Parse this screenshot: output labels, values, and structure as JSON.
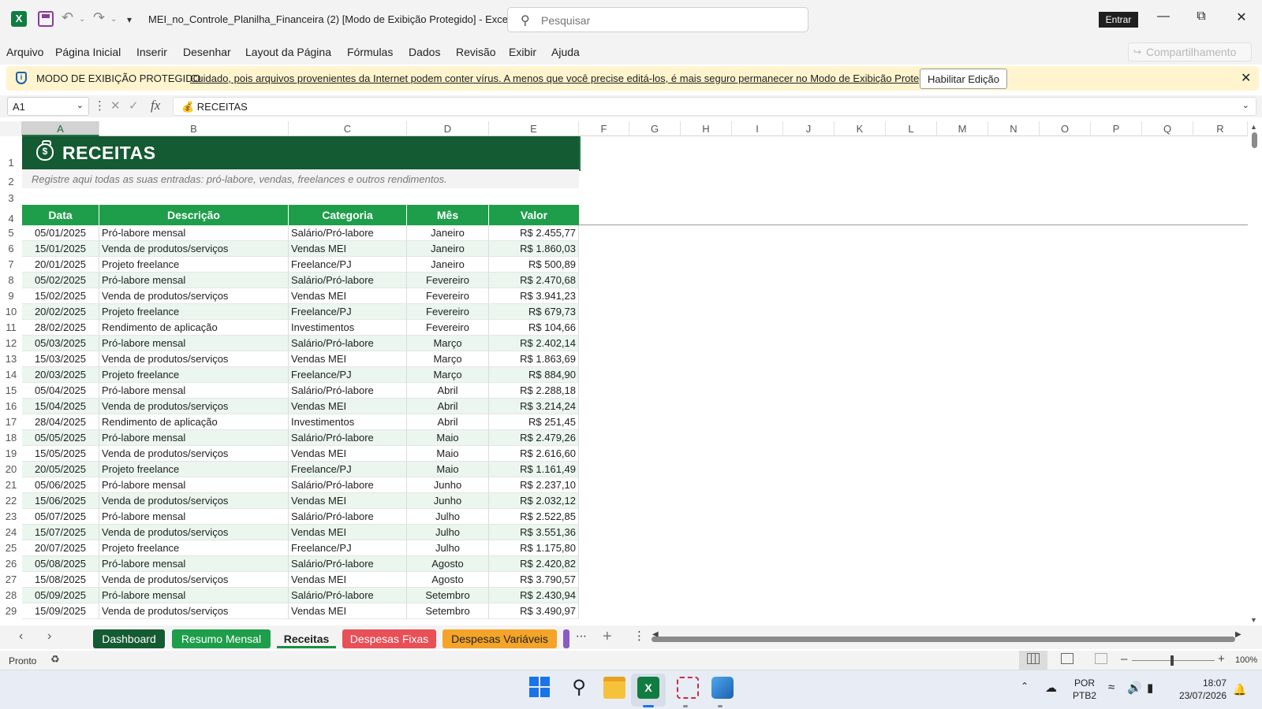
{
  "app": {
    "title": "MEI_no_Controle_Planilha_Financeira (2)  [Modo de Exibição Protegido]  -  Excel",
    "search_placeholder": "Pesquisar",
    "signin_label": "Entrar",
    "share_label": "Compartilhamento"
  },
  "menu": [
    "Arquivo",
    "Página Inicial",
    "Inserir",
    "Desenhar",
    "Layout da Página",
    "Fórmulas",
    "Dados",
    "Revisão",
    "Exibir",
    "Ajuda"
  ],
  "banner": {
    "title": "MODO DE EXIBIÇÃO PROTEGIDO",
    "message": "Cuidado, pois arquivos provenientes da Internet podem conter vírus. A menos que você precise editá-los, é mais seguro permanecer no Modo de  Exibição Protegido.",
    "enable_label": "Habilitar Edição"
  },
  "formula_bar": {
    "cell_ref": "A1",
    "content": "💰 RECEITAS"
  },
  "columns": [
    "A",
    "B",
    "C",
    "D",
    "E",
    "F",
    "G",
    "H",
    "I",
    "J",
    "K",
    "L",
    "M",
    "N",
    "O",
    "P",
    "Q",
    "R"
  ],
  "sheet": {
    "title": "RECEITAS",
    "subtitle": "Registre aqui todas as suas entradas: pró-labore, vendas, freelances e outros rendimentos.",
    "headers": [
      "Data",
      "Descrição",
      "Categoria",
      "Mês",
      "Valor"
    ],
    "rows": [
      [
        "05/01/2025",
        "Pró-labore mensal",
        "Salário/Pró-labore",
        "Janeiro",
        "R$ 2.455,77"
      ],
      [
        "15/01/2025",
        "Venda de produtos/serviços",
        "Vendas MEI",
        "Janeiro",
        "R$ 1.860,03"
      ],
      [
        "20/01/2025",
        "Projeto freelance",
        "Freelance/PJ",
        "Janeiro",
        "R$ 500,89"
      ],
      [
        "05/02/2025",
        "Pró-labore mensal",
        "Salário/Pró-labore",
        "Fevereiro",
        "R$ 2.470,68"
      ],
      [
        "15/02/2025",
        "Venda de produtos/serviços",
        "Vendas MEI",
        "Fevereiro",
        "R$ 3.941,23"
      ],
      [
        "20/02/2025",
        "Projeto freelance",
        "Freelance/PJ",
        "Fevereiro",
        "R$ 679,73"
      ],
      [
        "28/02/2025",
        "Rendimento de aplicação",
        "Investimentos",
        "Fevereiro",
        "R$ 104,66"
      ],
      [
        "05/03/2025",
        "Pró-labore mensal",
        "Salário/Pró-labore",
        "Março",
        "R$ 2.402,14"
      ],
      [
        "15/03/2025",
        "Venda de produtos/serviços",
        "Vendas MEI",
        "Março",
        "R$ 1.863,69"
      ],
      [
        "20/03/2025",
        "Projeto freelance",
        "Freelance/PJ",
        "Março",
        "R$ 884,90"
      ],
      [
        "05/04/2025",
        "Pró-labore mensal",
        "Salário/Pró-labore",
        "Abril",
        "R$ 2.288,18"
      ],
      [
        "15/04/2025",
        "Venda de produtos/serviços",
        "Vendas MEI",
        "Abril",
        "R$ 3.214,24"
      ],
      [
        "28/04/2025",
        "Rendimento de aplicação",
        "Investimentos",
        "Abril",
        "R$ 251,45"
      ],
      [
        "05/05/2025",
        "Pró-labore mensal",
        "Salário/Pró-labore",
        "Maio",
        "R$ 2.479,26"
      ],
      [
        "15/05/2025",
        "Venda de produtos/serviços",
        "Vendas MEI",
        "Maio",
        "R$ 2.616,60"
      ],
      [
        "20/05/2025",
        "Projeto freelance",
        "Freelance/PJ",
        "Maio",
        "R$ 1.161,49"
      ],
      [
        "05/06/2025",
        "Pró-labore mensal",
        "Salário/Pró-labore",
        "Junho",
        "R$ 2.237,10"
      ],
      [
        "15/06/2025",
        "Venda de produtos/serviços",
        "Vendas MEI",
        "Junho",
        "R$ 2.032,12"
      ],
      [
        "05/07/2025",
        "Pró-labore mensal",
        "Salário/Pró-labore",
        "Julho",
        "R$ 2.522,85"
      ],
      [
        "15/07/2025",
        "Venda de produtos/serviços",
        "Vendas MEI",
        "Julho",
        "R$ 3.551,36"
      ],
      [
        "20/07/2025",
        "Projeto freelance",
        "Freelance/PJ",
        "Julho",
        "R$ 1.175,80"
      ],
      [
        "05/08/2025",
        "Pró-labore mensal",
        "Salário/Pró-labore",
        "Agosto",
        "R$ 2.420,82"
      ],
      [
        "15/08/2025",
        "Venda de produtos/serviços",
        "Vendas MEI",
        "Agosto",
        "R$ 3.790,57"
      ],
      [
        "05/09/2025",
        "Pró-labore mensal",
        "Salário/Pró-labore",
        "Setembro",
        "R$ 2.430,94"
      ],
      [
        "15/09/2025",
        "Venda de produtos/serviços",
        "Vendas MEI",
        "Setembro",
        "R$ 3.490,97"
      ]
    ]
  },
  "sheet_tabs": {
    "dashboard": "Dashboard",
    "resumo": "Resumo Mensal",
    "receitas": "Receitas",
    "fixas": "Despesas Fixas",
    "variaveis": "Despesas Variáveis"
  },
  "status": {
    "ready": "Pronto",
    "zoom": "100%"
  },
  "tray": {
    "lang_top": "POR",
    "lang_bottom": "PTB2",
    "time": "18:07",
    "date": "23/07/2026"
  }
}
